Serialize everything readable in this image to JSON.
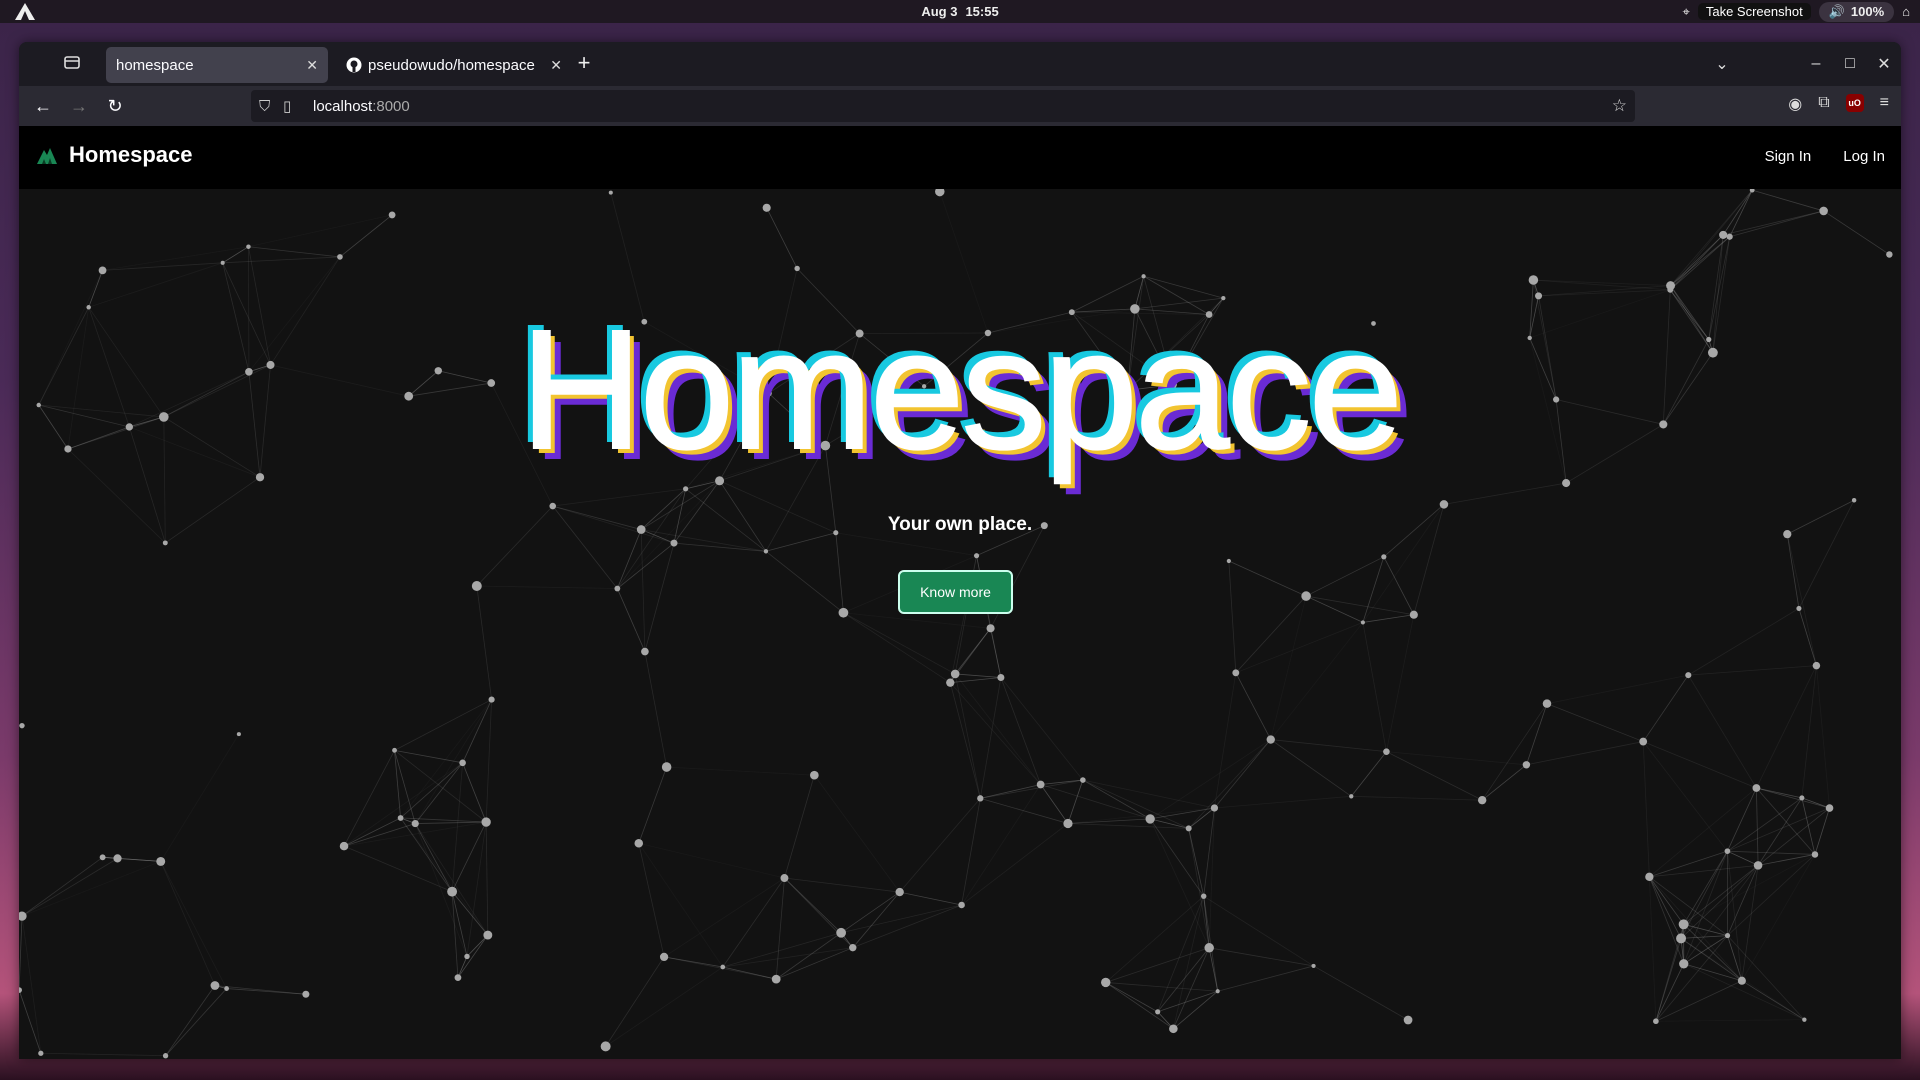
{
  "system_bar": {
    "date": "Aug 3",
    "time": "15:55",
    "tooltip": "Take Screenshot",
    "volume_level": "100%"
  },
  "browser": {
    "tabs": [
      {
        "label": "homespace",
        "active": true
      },
      {
        "label": "pseudowudo/homespace",
        "active": false
      }
    ],
    "url_host": "localhost",
    "url_port": ":8000"
  },
  "site": {
    "brand": "Homespace",
    "nav": {
      "sign_in": "Sign In",
      "log_in": "Log In"
    },
    "hero_title": "Homespace",
    "tagline": "Your own place.",
    "cta_label": "Know more",
    "colors": {
      "accent": "#198754",
      "title_cyan": "#18c9e0",
      "title_yellow": "#f2c430",
      "title_purple": "#6a2bd4"
    }
  }
}
